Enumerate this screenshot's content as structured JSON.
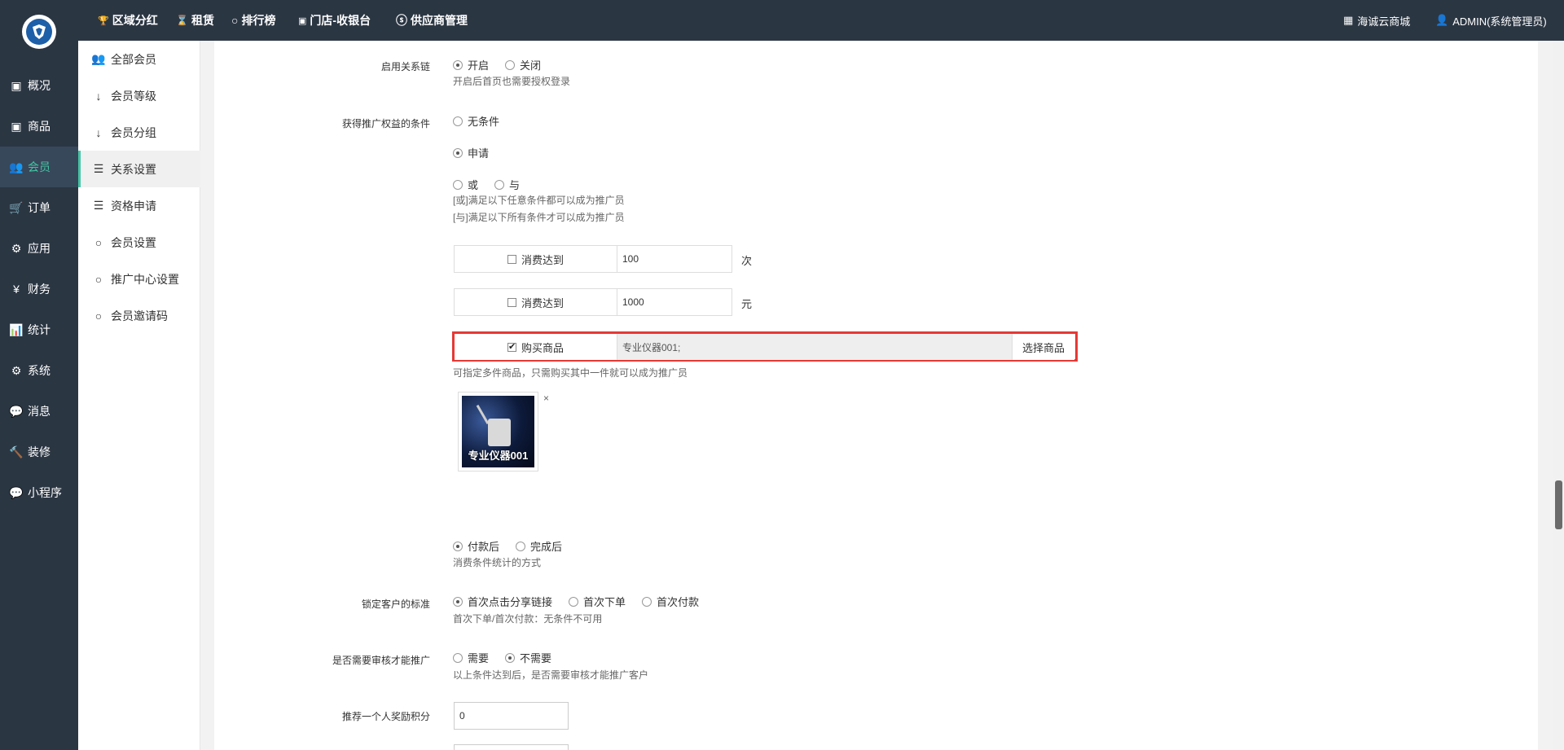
{
  "topnav": {
    "items": [
      {
        "icon": "trophy-icon",
        "glyph": "🏆",
        "label": "区域分红"
      },
      {
        "icon": "hourglass-icon",
        "glyph": "⌛",
        "label": "租赁"
      },
      {
        "icon": "circle-icon",
        "glyph": "○",
        "label": "排行榜"
      },
      {
        "icon": "cashier-icon",
        "glyph": "▣",
        "label": "门店-收银台"
      },
      {
        "icon": "skype-icon",
        "glyph": "ⓢ",
        "label": "供应商管理"
      }
    ],
    "shop_label": "海诚云商城",
    "user_label": "ADMIN(系统管理员)"
  },
  "sidebar": {
    "items": [
      {
        "icon": "overview-icon",
        "glyph": "▣",
        "label": "概况"
      },
      {
        "icon": "goods-icon",
        "glyph": "▣",
        "label": "商品"
      },
      {
        "icon": "members-icon",
        "glyph": "👥",
        "label": "会员"
      },
      {
        "icon": "cart-icon",
        "glyph": "🛒",
        "label": "订单"
      },
      {
        "icon": "apps-icon",
        "glyph": "⚙",
        "label": "应用"
      },
      {
        "icon": "yen-icon",
        "glyph": "¥",
        "label": "财务"
      },
      {
        "icon": "stats-icon",
        "glyph": "📊",
        "label": "统计"
      },
      {
        "icon": "system-icon",
        "glyph": "⚙",
        "label": "系统"
      },
      {
        "icon": "message-icon",
        "glyph": "💬",
        "label": "消息"
      },
      {
        "icon": "decorate-icon",
        "glyph": "🔨",
        "label": "装修"
      },
      {
        "icon": "wechat-icon",
        "glyph": "💬",
        "label": "小程序"
      }
    ]
  },
  "subnav": {
    "items": [
      {
        "icon": "users-icon",
        "glyph": "👥",
        "label": "全部会员"
      },
      {
        "icon": "sort-icon",
        "glyph": "↓",
        "label": "会员等级"
      },
      {
        "icon": "sort-alpha-icon",
        "glyph": "↓",
        "label": "会员分组"
      },
      {
        "icon": "sliders-icon",
        "glyph": "☰",
        "label": "关系设置"
      },
      {
        "icon": "sliders-icon",
        "glyph": "☰",
        "label": "资格申请"
      },
      {
        "icon": "circle-icon",
        "glyph": "○",
        "label": "会员设置"
      },
      {
        "icon": "circle-icon",
        "glyph": "○",
        "label": "推广中心设置"
      },
      {
        "icon": "circle-icon",
        "glyph": "○",
        "label": "会员邀请码"
      }
    ]
  },
  "form": {
    "relation_chain": {
      "label": "启用关系链",
      "opt_on": "开启",
      "opt_off": "关闭",
      "hint": "开启后首页也需要授权登录"
    },
    "promo_condition": {
      "label": "获得推广权益的条件",
      "opt_none": "无条件",
      "opt_apply": "申请",
      "opt_or": "或",
      "opt_and": "与",
      "hint_or": "[或]满足以下任意条件都可以成为推广员",
      "hint_and": "[与]满足以下所有条件才可以成为推广员"
    },
    "cond_times": {
      "label": "消费达到",
      "value": "100",
      "unit": "次"
    },
    "cond_amount": {
      "label": "消费达到",
      "value": "1000",
      "unit": "元"
    },
    "cond_goods": {
      "label": "购买商品",
      "value": "专业仪器001;",
      "button": "选择商品",
      "hint": "可指定多件商品，只需购买其中一件就可以成为推广员",
      "thumb_title": "专业仪器001",
      "remove": "×"
    },
    "stat_method": {
      "opt_paid": "付款后",
      "opt_done": "完成后",
      "hint": "消费条件统计的方式"
    },
    "lock_standard": {
      "label": "锁定客户的标准",
      "opt_click": "首次点击分享链接",
      "opt_order": "首次下单",
      "opt_pay": "首次付款",
      "hint": "首次下单/首次付款：无条件不可用"
    },
    "need_review": {
      "label": "是否需要审核才能推广",
      "opt_yes": "需要",
      "opt_no": "不需要",
      "hint": "以上条件达到后，是否需要审核才能推广客户"
    },
    "reward_points": {
      "label": "推荐一个人奖励积分",
      "value": "0"
    }
  }
}
